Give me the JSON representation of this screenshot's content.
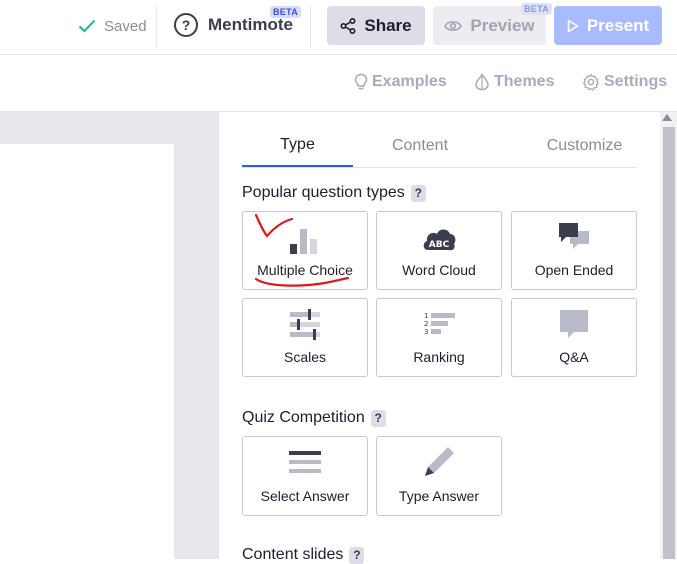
{
  "header": {
    "saved_label": "Saved",
    "mentimote_label": "Mentimote",
    "mentimote_badge": "BETA",
    "share_label": "Share",
    "preview_label": "Preview",
    "preview_badge": "BETA",
    "present_label": "Present"
  },
  "subnav": {
    "examples": "Examples",
    "themes": "Themes",
    "settings": "Settings"
  },
  "tabs": [
    {
      "label": "Type"
    },
    {
      "label": "Content"
    },
    {
      "label": "Customize"
    }
  ],
  "sections": {
    "popular": "Popular question types",
    "quiz": "Quiz Competition",
    "content": "Content slides",
    "help": "?"
  },
  "popular_types": [
    {
      "label": "Multiple Choice",
      "icon": "bar-chart-icon"
    },
    {
      "label": "Word Cloud",
      "icon": "word-cloud-icon"
    },
    {
      "label": "Open Ended",
      "icon": "speech-bubbles-icon"
    },
    {
      "label": "Scales",
      "icon": "sliders-icon"
    },
    {
      "label": "Ranking",
      "icon": "ranking-icon"
    },
    {
      "label": "Q&A",
      "icon": "qa-bubble-icon"
    }
  ],
  "quiz_types": [
    {
      "label": "Select Answer",
      "icon": "list-lines-icon"
    },
    {
      "label": "Type Answer",
      "icon": "pencil-icon"
    }
  ],
  "word_cloud_icon_text": "ABC",
  "ranking_numbers": [
    "1",
    "2",
    "3"
  ],
  "colors": {
    "accent_blue": "#2b5ee0",
    "present_bg": "#a9bbff",
    "saved_check": "#2fb597",
    "annotation_red": "#e0161b"
  }
}
